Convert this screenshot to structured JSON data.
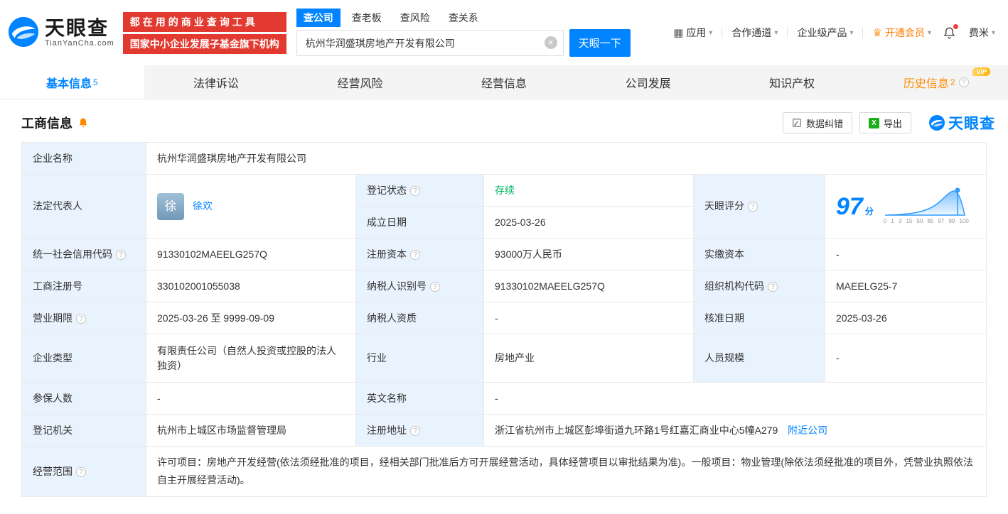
{
  "colors": {
    "brand": "#0084ff",
    "red": "#e23a30",
    "green": "#00b365",
    "orange": "#ff7d00",
    "label_bg": "#e9f3fd"
  },
  "icons": {
    "caret": "▾",
    "grid": "▦",
    "crown": "♛",
    "clear": "×",
    "help": "?",
    "excel": "X"
  },
  "header": {
    "logo": {
      "brand": "天眼查",
      "domain": "TianYanCha.com"
    },
    "promo": {
      "line1": "都在用的商业查询工具",
      "line2": "国家中小企业发展子基金旗下机构"
    },
    "search": {
      "tabs": [
        {
          "label": "查公司"
        },
        {
          "label": "查老板"
        },
        {
          "label": "查风险"
        },
        {
          "label": "查关系"
        }
      ],
      "value": "杭州华润盛琪房地产开发有限公司",
      "button": "天眼一下"
    },
    "nav": {
      "apps": "应用",
      "cooperation": "合作通道",
      "enterprise": "企业级产品",
      "vip": "开通会员",
      "user": "费米"
    }
  },
  "tabs": [
    {
      "label": "基本信息",
      "badge": "5"
    },
    {
      "label": "法律诉讼"
    },
    {
      "label": "经营风险"
    },
    {
      "label": "经营信息"
    },
    {
      "label": "公司发展"
    },
    {
      "label": "知识产权"
    },
    {
      "label": "历史信息",
      "badge": "2",
      "tag": "VIP"
    }
  ],
  "section": {
    "title": "工商信息",
    "correct_btn": "数据纠错",
    "export_btn": "导出",
    "watermark": "天眼查"
  },
  "info": {
    "company_name": {
      "label": "企业名称",
      "value": "杭州华润盛琪房地产开发有限公司"
    },
    "legal_rep": {
      "label": "法定代表人",
      "avatar": "徐",
      "value": "徐欢"
    },
    "reg_status": {
      "label": "登记状态",
      "value": "存续"
    },
    "establish_date": {
      "label": "成立日期",
      "value": "2025-03-26"
    },
    "score": {
      "label": "天眼评分",
      "value": "97",
      "unit": "分",
      "axis": [
        "0",
        "1",
        "3",
        "15",
        "50",
        "85",
        "97",
        "99",
        "100"
      ]
    },
    "credit_code": {
      "label": "统一社会信用代码",
      "value": "91330102MAEELG257Q"
    },
    "reg_capital": {
      "label": "注册资本",
      "value": "93000万人民币"
    },
    "paid_capital": {
      "label": "实缴资本",
      "value": "-"
    },
    "reg_number": {
      "label": "工商注册号",
      "value": "330102001055038"
    },
    "taxpayer_id": {
      "label": "纳税人识别号",
      "value": "91330102MAEELG257Q"
    },
    "org_code": {
      "label": "组织机构代码",
      "value": "MAEELG25-7"
    },
    "business_term": {
      "label": "营业期限",
      "value": "2025-03-26 至 9999-09-09"
    },
    "taxpayer_quality": {
      "label": "纳税人资质",
      "value": "-"
    },
    "approval_date": {
      "label": "核准日期",
      "value": "2025-03-26"
    },
    "company_type": {
      "label": "企业类型",
      "value": "有限责任公司（自然人投资或控股的法人独资）"
    },
    "industry": {
      "label": "行业",
      "value": "房地产业"
    },
    "staff_size": {
      "label": "人员规模",
      "value": "-"
    },
    "insured_count": {
      "label": "参保人数",
      "value": "-"
    },
    "english_name": {
      "label": "英文名称",
      "value": "-"
    },
    "reg_authority": {
      "label": "登记机关",
      "value": "杭州市上城区市场监督管理局"
    },
    "reg_address": {
      "label": "注册地址",
      "value": "浙江省杭州市上城区彭埠街道九环路1号红嘉汇商业中心5幢A279",
      "link": "附近公司"
    },
    "business_scope": {
      "label": "经营范围",
      "value": "许可项目：房地产开发经营(依法须经批准的项目，经相关部门批准后方可开展经营活动，具体经营项目以审批结果为准)。一般项目：物业管理(除依法须经批准的项目外，凭营业执照依法自主开展经营活动)。"
    }
  }
}
